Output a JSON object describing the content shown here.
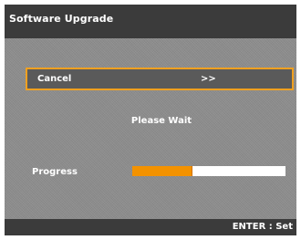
{
  "dialog": {
    "title": "Software Upgrade",
    "option": {
      "label": "Cancel",
      "arrow": ">>"
    },
    "status": "Please Wait",
    "progress": {
      "label": "Progress",
      "fraction": 0.39
    },
    "footer": {
      "hint": "ENTER : Set"
    }
  },
  "colors": {
    "highlight_border": "#f0a020",
    "progress_fill": "#f39200",
    "bar_background": "#3b3b3b"
  }
}
